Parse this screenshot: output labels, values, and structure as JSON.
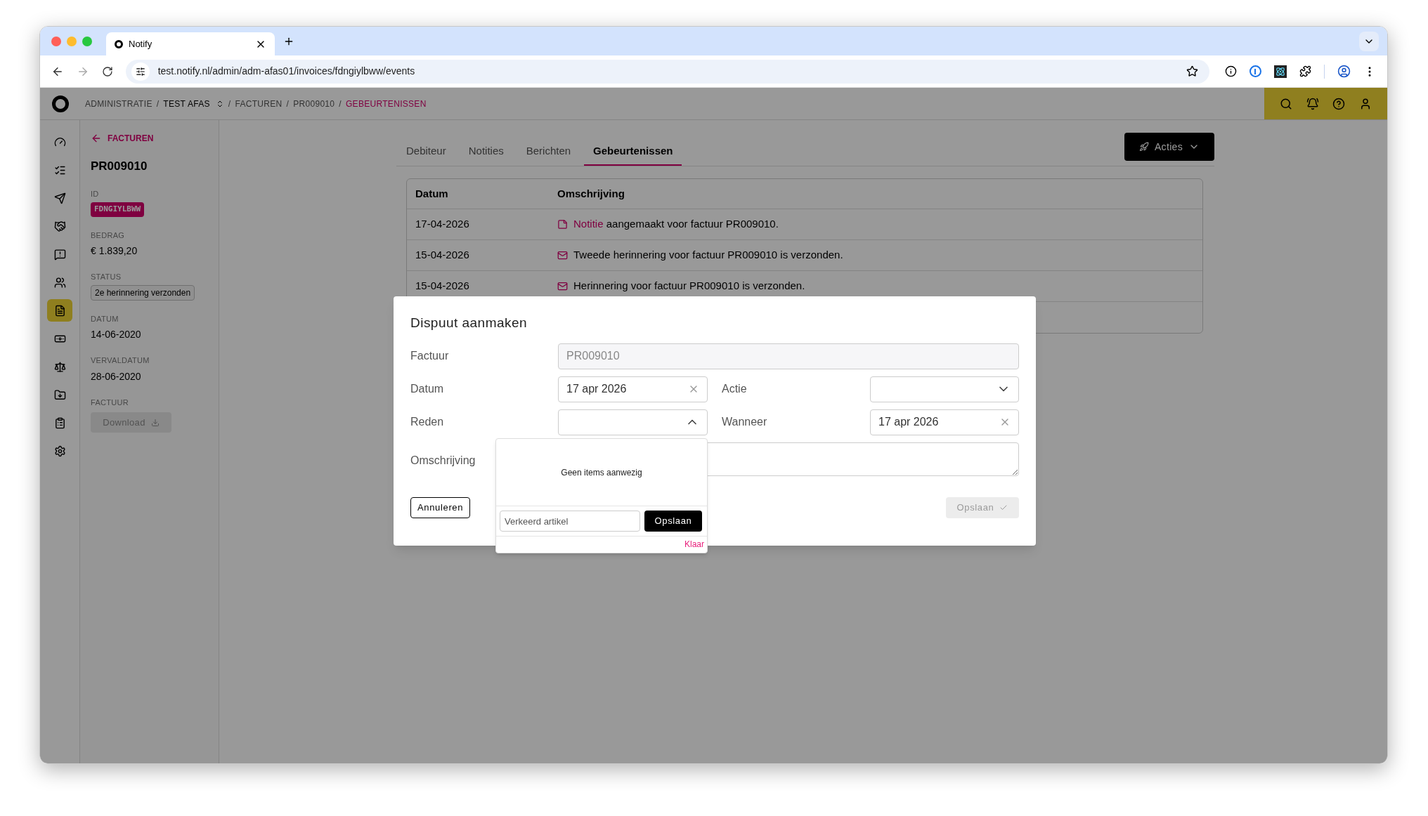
{
  "browser": {
    "tab_title": "Notify",
    "url": "test.notify.nl/admin/adm-afas01/invoices/fdngiylbww/events"
  },
  "breadcrumb_separator": "/",
  "breadcrumb": [
    {
      "label": "ADMINISTRATIE",
      "kind": "plain"
    },
    {
      "label": "TEST AFAS",
      "kind": "switch"
    },
    {
      "label": "FACTUREN",
      "kind": "plain"
    },
    {
      "label": "PR009010",
      "kind": "plain"
    },
    {
      "label": "GEBEURTENISSEN",
      "kind": "current"
    }
  ],
  "nav": [
    {
      "selected": false
    },
    {
      "selected": false
    },
    {
      "selected": false
    },
    {
      "selected": false
    },
    {
      "selected": false
    },
    {
      "selected": false
    },
    {
      "selected": true
    },
    {
      "selected": false
    },
    {
      "selected": false
    },
    {
      "selected": false
    },
    {
      "selected": false
    },
    {
      "selected": false
    }
  ],
  "invoice": {
    "back": "FACTUREN",
    "number": "PR009010",
    "id_label": "ID",
    "id": "FDNGIYLBWW",
    "amount_label": "BEDRAG",
    "amount": "€ 1.839,20",
    "status_label": "STATUS",
    "status": "2e herinnering verzonden",
    "date_label": "DATUM",
    "date": "14-06-2020",
    "due_label": "VERVALDATUM",
    "due": "28-06-2020",
    "file_label": "FACTUUR",
    "download": {
      "label": "Download",
      "disabled": true
    }
  },
  "tabs": [
    {
      "label": "Debiteur",
      "selected": false
    },
    {
      "label": "Notities",
      "selected": false
    },
    {
      "label": "Berichten",
      "selected": false
    },
    {
      "label": "Gebeurtenissen",
      "selected": true
    }
  ],
  "actions_button": "Acties",
  "table": {
    "columns": [
      "Datum",
      "Omschrijving"
    ],
    "rows": [
      {
        "date": "17-04-2026",
        "kind": "note",
        "link": "Notitie",
        "text": "aangemaakt voor factuur PR009010."
      },
      {
        "date": "15-04-2026",
        "kind": "mail",
        "text": "Tweede herinnering voor factuur PR009010 is verzonden."
      },
      {
        "date": "15-04-2026",
        "kind": "mail",
        "text": "Herinnering voor factuur PR009010 is verzonden."
      }
    ]
  },
  "modal": {
    "title": "Dispuut aanmaken",
    "invoice_label": "Factuur",
    "invoice_value": "PR009010",
    "date_label": "Datum",
    "date_value": "17 apr 2026",
    "action_label": "Actie",
    "reason_label": "Reden",
    "when_label": "Wanneer",
    "when_value": "17 apr 2026",
    "description_label": "Omschrijving",
    "cancel": "Annuleren",
    "save": {
      "label": "Opslaan",
      "disabled": true
    }
  },
  "reason_dropdown": {
    "expanded": true,
    "empty_text": "Geen items aanwezig",
    "new_value": "Verkeerd artikel",
    "save": "Opslaan",
    "done": "Klaar"
  }
}
